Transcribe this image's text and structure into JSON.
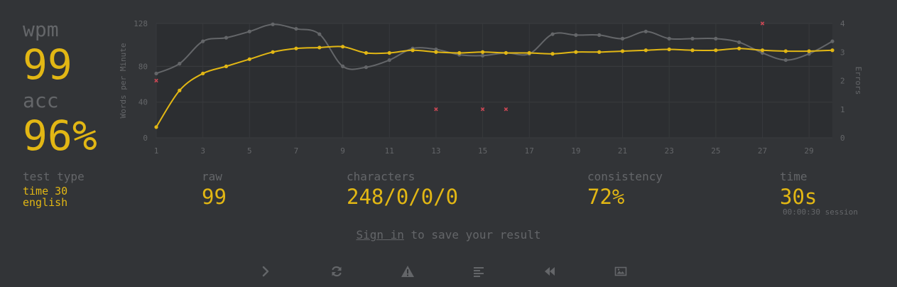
{
  "stats": {
    "wpm_label": "wpm",
    "wpm_value": "99",
    "acc_label": "acc",
    "acc_value": "96%"
  },
  "details": {
    "test_type_label": "test type",
    "test_type_line1": "time 30",
    "test_type_line2": "english",
    "raw_label": "raw",
    "raw_value": "99",
    "characters_label": "characters",
    "characters_value": "248/0/0/0",
    "consistency_label": "consistency",
    "consistency_value": "72%",
    "time_label": "time",
    "time_value": "30s",
    "time_session": "00:00:30 session"
  },
  "signin": {
    "link_label": "Sign in",
    "rest": " to save your result"
  },
  "actions": [
    {
      "name": "next-test-button",
      "icon": "chevron-right-icon"
    },
    {
      "name": "restart-test-button",
      "icon": "refresh-icon"
    },
    {
      "name": "report-question-button",
      "icon": "warning-icon"
    },
    {
      "name": "word-history-button",
      "icon": "align-left-icon"
    },
    {
      "name": "watch-replay-button",
      "icon": "backward-icon"
    },
    {
      "name": "save-screenshot-button",
      "icon": "image-icon"
    }
  ],
  "colors": {
    "background": "#323437",
    "main": "#e2b714",
    "sub": "#646669",
    "error": "#ca4754",
    "plot_bg": "#2c2e31"
  },
  "chart_data": {
    "type": "line",
    "ylabel": "Words per Minute",
    "y2label": "Errors",
    "x": [
      1,
      2,
      3,
      4,
      5,
      6,
      7,
      8,
      9,
      10,
      11,
      12,
      13,
      14,
      15,
      16,
      17,
      18,
      19,
      20,
      21,
      22,
      23,
      24,
      25,
      26,
      27,
      28,
      29,
      30
    ],
    "xticks": [
      "1",
      "3",
      "5",
      "7",
      "9",
      "11",
      "13",
      "15",
      "17",
      "19",
      "21",
      "23",
      "25",
      "27",
      "29"
    ],
    "yticks": [
      "0",
      "40",
      "80",
      "128"
    ],
    "y2ticks": [
      "0",
      "1",
      "2",
      "3",
      "4"
    ],
    "ylim": [
      0,
      128
    ],
    "y2lim": [
      0,
      4
    ],
    "series": [
      {
        "role": "raw",
        "values": [
          72,
          83,
          108,
          112,
          119,
          127,
          122,
          116,
          80,
          79,
          87,
          100,
          99,
          93,
          92,
          95,
          94,
          116,
          115,
          115,
          111,
          119,
          111,
          111,
          111,
          107,
          95,
          87,
          94,
          108
        ]
      },
      {
        "role": "wpm",
        "values": [
          12,
          53,
          72,
          80,
          88,
          96,
          100,
          101,
          102,
          95,
          95,
          98,
          96,
          95,
          96,
          95,
          95,
          94,
          96,
          96,
          97,
          98,
          99,
          98,
          98,
          100,
          98,
          97,
          97,
          98
        ]
      }
    ],
    "errors": [
      {
        "x": 1,
        "count": 2
      },
      {
        "x": 13,
        "count": 1
      },
      {
        "x": 15,
        "count": 1
      },
      {
        "x": 16,
        "count": 1
      },
      {
        "x": 27,
        "count": 4
      }
    ]
  }
}
